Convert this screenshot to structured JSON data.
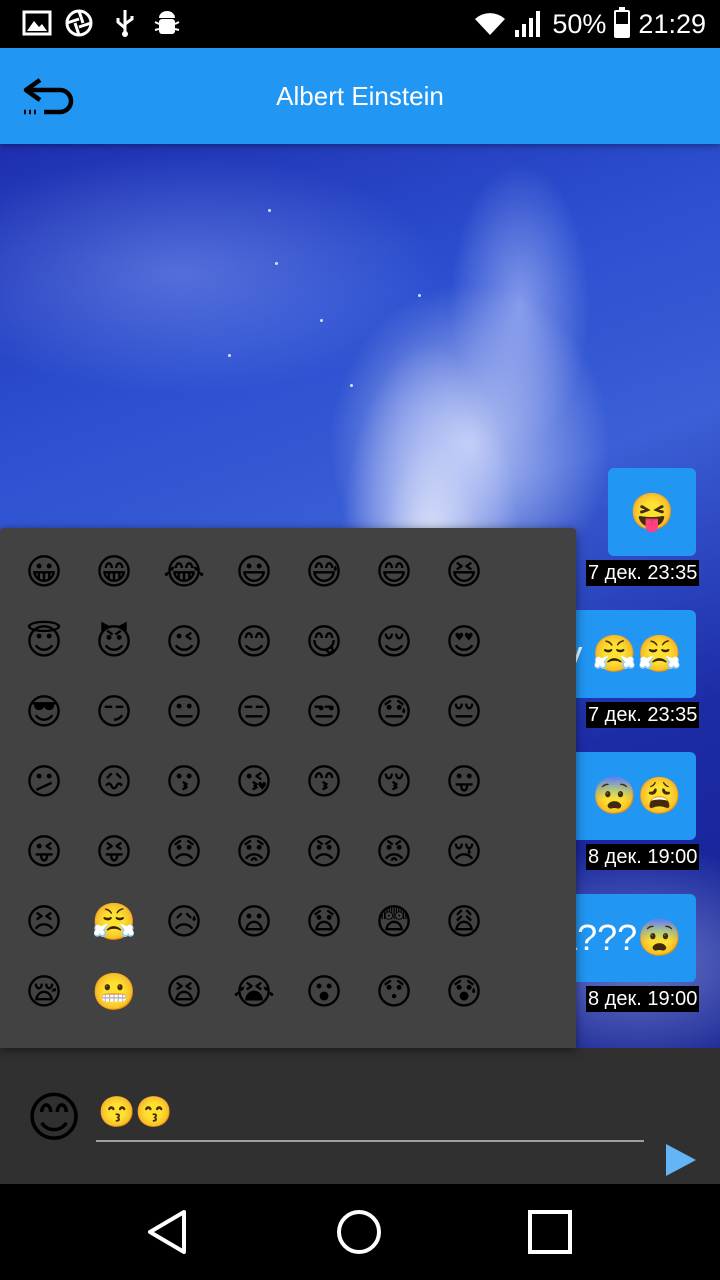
{
  "status_bar": {
    "battery_percent": "50%",
    "battery_level": 0.5,
    "time": "21:29",
    "left_icons": [
      "image-icon",
      "aperture-icon",
      "usb-icon",
      "android-debug-icon"
    ],
    "right_icons": [
      "wifi-icon",
      "signal-icon",
      "battery-icon"
    ]
  },
  "app_bar": {
    "title": "Albert Einstein",
    "back_icon": "back-arrow-icon",
    "color": "#2196f3"
  },
  "messages": [
    {
      "text": "😝",
      "timestamp": "7 дек. 23:35"
    },
    {
      "text": "у 😤😤",
      "timestamp": "7 дек. 23:35"
    },
    {
      "text": "😨😩",
      "timestamp": "8 дек. 19:00"
    },
    {
      "text": "а???😨",
      "timestamp": "8 дек. 19:00"
    }
  ],
  "emoji_panel": {
    "emojis": [
      "😀",
      "😁",
      "😂",
      "😃",
      "😅",
      "😄",
      "😆",
      "😇",
      "😈",
      "😉",
      "😊",
      "😋",
      "😌",
      "😍",
      "😎",
      "😏",
      "😐",
      "😑",
      "😒",
      "😓",
      "😔",
      "😕",
      "😖",
      "😗",
      "😘",
      "😙",
      "😚",
      "😛",
      "😜",
      "😝",
      "😞",
      "😟",
      "😠",
      "😡",
      "😢",
      "😣",
      "😤",
      "😥",
      "😦",
      "😧",
      "😨",
      "😩",
      "😪",
      "😬",
      "😫",
      "😭",
      "😮",
      "😯",
      "😰"
    ]
  },
  "input_bar": {
    "smile_icon": "😊",
    "input_value": "😙😙",
    "send_icon": "send-icon"
  },
  "nav_bar": {
    "icons": [
      "back-triangle-icon",
      "home-circle-icon",
      "recents-square-icon"
    ]
  }
}
